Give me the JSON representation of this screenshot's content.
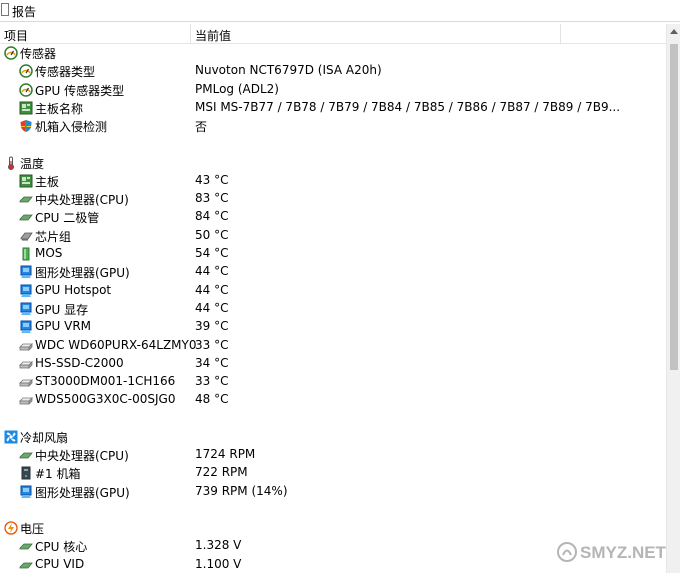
{
  "toolbar": {
    "title": "报告"
  },
  "columns": {
    "item": "项目",
    "value": "当前值"
  },
  "rows": [
    {
      "kind": "group",
      "icon": "sensor-gauge-icon",
      "name": "传感器",
      "value": ""
    },
    {
      "kind": "item",
      "icon": "sensor-gauge-icon",
      "name": "传感器类型",
      "value": "Nuvoton NCT6797D  (ISA A20h)"
    },
    {
      "kind": "item",
      "icon": "gpu-sensor-icon",
      "name": "GPU 传感器类型",
      "value": "PMLog  (ADL2)"
    },
    {
      "kind": "item",
      "icon": "motherboard-icon",
      "name": "主板名称",
      "value": "MSI MS-7B77 / 7B78 / 7B79 / 7B84 / 7B85 / 7B86 / 7B87 / 7B89 / 7B9..."
    },
    {
      "kind": "item",
      "icon": "shield-icon",
      "name": "机箱入侵检测",
      "value": "否"
    },
    {
      "kind": "spacer"
    },
    {
      "kind": "group",
      "icon": "thermometer-icon",
      "name": "温度",
      "value": ""
    },
    {
      "kind": "item",
      "icon": "motherboard-icon",
      "name": "主板",
      "value": "43 °C"
    },
    {
      "kind": "item",
      "icon": "cpu-icon",
      "name": "中央处理器(CPU)",
      "value": "83 °C"
    },
    {
      "kind": "item",
      "icon": "cpu-icon",
      "name": "CPU 二极管",
      "value": "84 °C"
    },
    {
      "kind": "item",
      "icon": "chipset-icon",
      "name": "芯片组",
      "value": "50 °C"
    },
    {
      "kind": "item",
      "icon": "mos-icon",
      "name": "MOS",
      "value": "54 °C"
    },
    {
      "kind": "item",
      "icon": "gpu-icon",
      "name": "图形处理器(GPU)",
      "value": "44 °C"
    },
    {
      "kind": "item",
      "icon": "gpu-icon",
      "name": "GPU Hotspot",
      "value": "44 °C"
    },
    {
      "kind": "item",
      "icon": "gpu-icon",
      "name": "GPU 显存",
      "value": "44 °C"
    },
    {
      "kind": "item",
      "icon": "gpu-icon",
      "name": "GPU VRM",
      "value": "39 °C"
    },
    {
      "kind": "item",
      "icon": "hard-drive-icon",
      "name": "WDC WD60PURX-64LZMY0",
      "value": "33 °C"
    },
    {
      "kind": "item",
      "icon": "hard-drive-icon",
      "name": "HS-SSD-C2000",
      "value": "34 °C"
    },
    {
      "kind": "item",
      "icon": "hard-drive-icon",
      "name": "ST3000DM001-1CH166",
      "value": "33 °C"
    },
    {
      "kind": "item",
      "icon": "hard-drive-icon",
      "name": "WDS500G3X0C-00SJG0",
      "value": "48 °C"
    },
    {
      "kind": "spacer"
    },
    {
      "kind": "group",
      "icon": "fan-icon",
      "name": "冷却风扇",
      "value": ""
    },
    {
      "kind": "item",
      "icon": "cpu-icon",
      "name": "中央处理器(CPU)",
      "value": "1724 RPM"
    },
    {
      "kind": "item",
      "icon": "case-icon",
      "name": "#1 机箱",
      "value": "722 RPM"
    },
    {
      "kind": "item",
      "icon": "gpu-icon",
      "name": "图形处理器(GPU)",
      "value": "739 RPM  (14%)"
    },
    {
      "kind": "spacer"
    },
    {
      "kind": "group",
      "icon": "voltage-icon",
      "name": "电压",
      "value": ""
    },
    {
      "kind": "item",
      "icon": "cpu-icon",
      "name": "CPU 核心",
      "value": "1.328 V"
    },
    {
      "kind": "item",
      "icon": "cpu-icon",
      "name": "CPU VID",
      "value": "1.100 V"
    }
  ],
  "watermark": "SMYZ.NET"
}
